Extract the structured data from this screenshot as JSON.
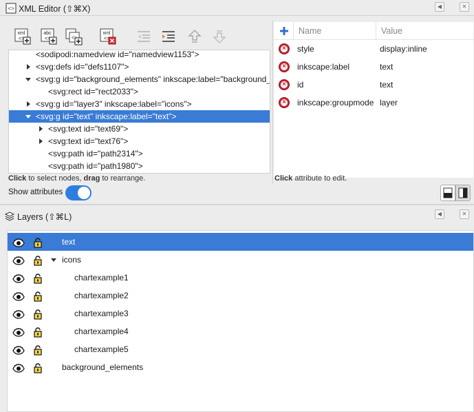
{
  "xml_editor": {
    "title": "XML Editor (⇧⌘X)",
    "toolbar": [
      "new-element-node",
      "new-text-node",
      "duplicate-node",
      "delete-node",
      "unindent-node",
      "indent-node",
      "raise-node",
      "lower-node"
    ],
    "toolbar_labels": {
      "new_element": "xml",
      "new_text": "abc",
      "delete": "xml"
    },
    "tree": [
      {
        "text": "<sodipodi:namedview id=\"namedview1153\">",
        "indent": 0,
        "toggle": "none",
        "selected": false
      },
      {
        "text": "<svg:defs id=\"defs1107\">",
        "indent": 0,
        "toggle": "right",
        "selected": false
      },
      {
        "text": "<svg:g id=\"background_elements\" inkscape:label=\"background_",
        "indent": 0,
        "toggle": "down",
        "selected": false
      },
      {
        "text": "<svg:rect id=\"rect2033\">",
        "indent": 1,
        "toggle": "none",
        "selected": false
      },
      {
        "text": "<svg:g id=\"layer3\" inkscape:label=\"icons\">",
        "indent": 0,
        "toggle": "right",
        "selected": false
      },
      {
        "text": "<svg:g id=\"text\" inkscape:label=\"text\">",
        "indent": 0,
        "toggle": "down",
        "selected": true
      },
      {
        "text": "<svg:text id=\"text69\">",
        "indent": 1,
        "toggle": "right",
        "selected": false
      },
      {
        "text": "<svg:text id=\"text76\">",
        "indent": 1,
        "toggle": "right",
        "selected": false
      },
      {
        "text": "<svg:path id=\"path2314\">",
        "indent": 1,
        "toggle": "none",
        "selected": false
      },
      {
        "text": "<svg:path id=\"path1980\">",
        "indent": 1,
        "toggle": "none",
        "selected": false
      }
    ],
    "tree_hint": {
      "b1": "Click",
      "t1": " to select nodes, ",
      "b2": "drag",
      "t2": " to rearrange."
    },
    "show_attributes_label": "Show attributes",
    "show_attributes_on": true,
    "attributes": {
      "col_name": "Name",
      "col_value": "Value",
      "rows": [
        {
          "name": "style",
          "value": "display:inline"
        },
        {
          "name": "inkscape:label",
          "value": "text"
        },
        {
          "name": "id",
          "value": "text"
        },
        {
          "name": "inkscape:groupmode",
          "value": "layer"
        }
      ],
      "hint": {
        "b1": "Click",
        "t1": " attribute to edit."
      }
    }
  },
  "layers_panel": {
    "title": "Layers (⇧⌘L)",
    "rows": [
      {
        "label": "text",
        "indent": 0,
        "toggle": "none",
        "selected": true
      },
      {
        "label": "icons",
        "indent": 0,
        "toggle": "down",
        "selected": false
      },
      {
        "label": "chartexample1",
        "indent": 1,
        "toggle": "none",
        "selected": false
      },
      {
        "label": "chartexample2",
        "indent": 1,
        "toggle": "none",
        "selected": false
      },
      {
        "label": "chartexample3",
        "indent": 1,
        "toggle": "none",
        "selected": false
      },
      {
        "label": "chartexample4",
        "indent": 1,
        "toggle": "none",
        "selected": false
      },
      {
        "label": "chartexample5",
        "indent": 1,
        "toggle": "none",
        "selected": false
      },
      {
        "label": "background_elements",
        "indent": 0,
        "toggle": "none",
        "selected": false
      }
    ]
  },
  "colors": {
    "selection": "#3a7bd5",
    "toggle": "#2f7de1",
    "delete": "#c8242f"
  }
}
